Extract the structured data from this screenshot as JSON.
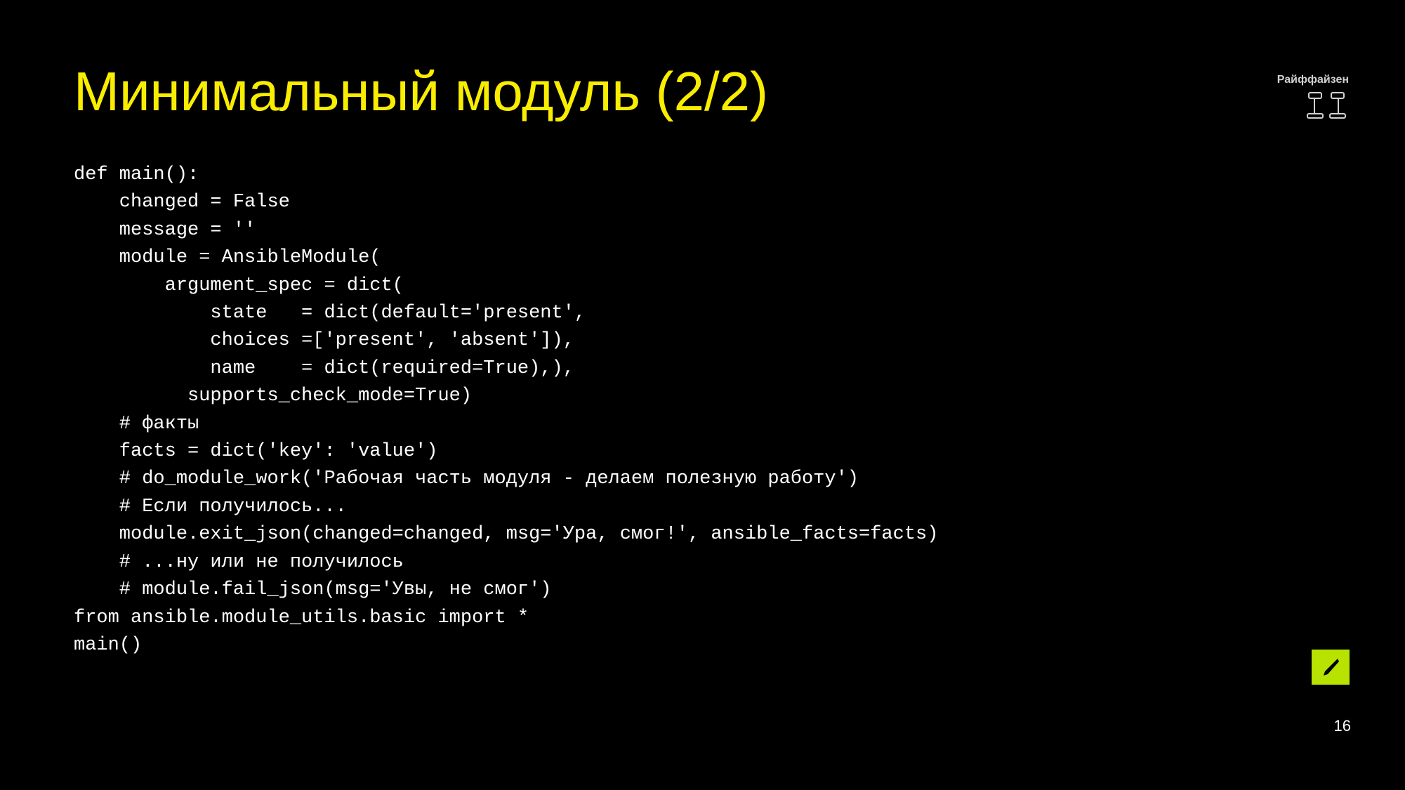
{
  "title": "Минимальный модуль (2/2)",
  "logo": "Райффайзен",
  "code": "def main():\n    changed = False\n    message = ''\n    module = AnsibleModule(\n        argument_spec = dict(\n            state   = dict(default='present',\n            choices =['present', 'absent']),\n            name    = dict(required=True),),\n          supports_check_mode=True)\n    # факты\n    facts = dict('key': 'value')\n    # do_module_work('Рабочая часть модуля - делаем полезную работу')\n    # Если получилось...\n    module.exit_json(changed=changed, msg='Ура, смог!', ansible_facts=facts)\n    # ...ну или не получилось\n    # module.fail_json(msg='Увы, не смог')\nfrom ansible.module_utils.basic import *\nmain()",
  "pageNumber": "16"
}
